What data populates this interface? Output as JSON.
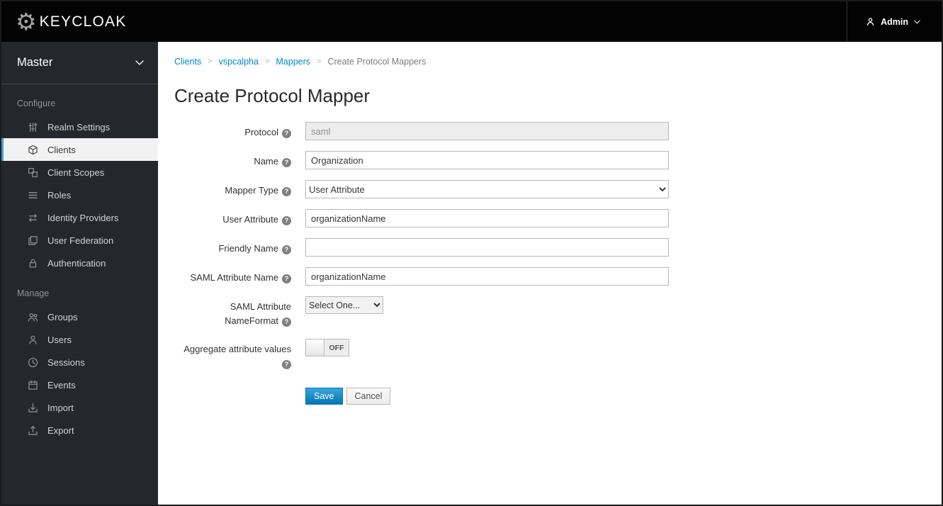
{
  "header": {
    "brand": "KEYCLOAK",
    "user": "Admin"
  },
  "sidebar": {
    "realm": "Master",
    "sections": [
      {
        "label": "Configure",
        "items": [
          {
            "label": "Realm Settings"
          },
          {
            "label": "Clients"
          },
          {
            "label": "Client Scopes"
          },
          {
            "label": "Roles"
          },
          {
            "label": "Identity Providers"
          },
          {
            "label": "User Federation"
          },
          {
            "label": "Authentication"
          }
        ]
      },
      {
        "label": "Manage",
        "items": [
          {
            "label": "Groups"
          },
          {
            "label": "Users"
          },
          {
            "label": "Sessions"
          },
          {
            "label": "Events"
          },
          {
            "label": "Import"
          },
          {
            "label": "Export"
          }
        ]
      }
    ]
  },
  "breadcrumb": {
    "items": [
      "Clients",
      "vspcalpha",
      "Mappers",
      "Create Protocol Mappers"
    ]
  },
  "page": {
    "title": "Create Protocol Mapper"
  },
  "form": {
    "fields": {
      "protocol": {
        "label": "Protocol",
        "value": "saml",
        "disabled": true
      },
      "name": {
        "label": "Name",
        "value": "Organization"
      },
      "mapper_type": {
        "label": "Mapper Type",
        "value": "User Attribute"
      },
      "user_attribute": {
        "label": "User Attribute",
        "value": "organizationName"
      },
      "friendly_name": {
        "label": "Friendly Name",
        "value": ""
      },
      "saml_attribute_name": {
        "label": "SAML Attribute Name",
        "value": "organizationName"
      },
      "saml_name_format": {
        "label": "SAML Attribute NameFormat",
        "value": "Select One..."
      },
      "aggregate": {
        "label": "Aggregate attribute values",
        "state": "OFF"
      }
    },
    "buttons": {
      "save": "Save",
      "cancel": "Cancel"
    }
  },
  "icons": {
    "help": "?",
    "breadcrumb_sep": ">"
  },
  "colors": {
    "accent": "#0088ce",
    "active_indicator": "#39a5dc",
    "header_bg": "#030303",
    "sidebar_bg": "#24282c"
  }
}
